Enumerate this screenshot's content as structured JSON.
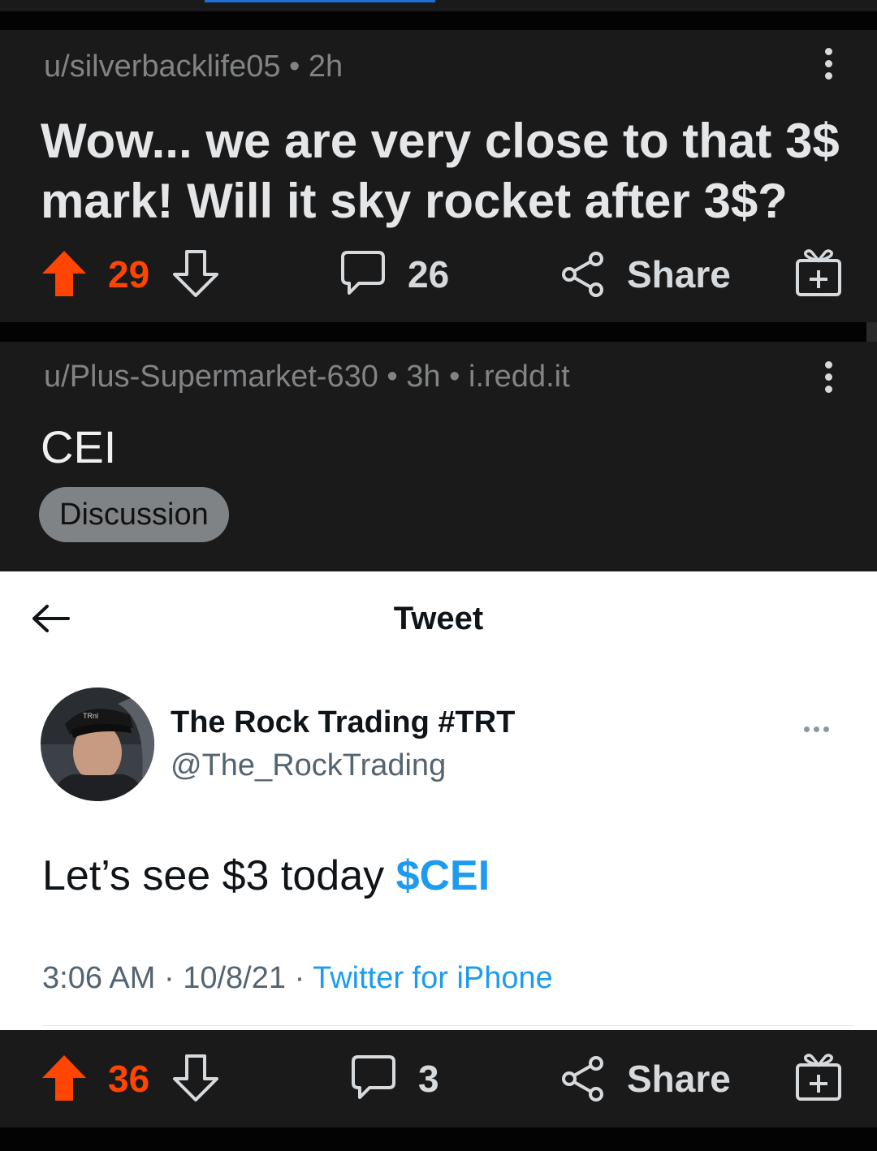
{
  "post1": {
    "author": "u/silverbacklife05",
    "separator": "•",
    "age": "2h",
    "title": "Wow... we are very close to that 3$ mark! Will it sky rocket after 3$?",
    "votes": "29",
    "comments": "26",
    "share_label": "Share"
  },
  "post2": {
    "author": "u/Plus-Supermarket-630",
    "separator": "•",
    "age": "3h",
    "domain": "i.redd.it",
    "title": "CEI",
    "flair": "Discussion",
    "votes": "36",
    "comments": "3",
    "share_label": "Share"
  },
  "tweet": {
    "header_title": "Tweet",
    "display_name": "The Rock Trading #TRT",
    "handle": "@The_RockTrading",
    "text_plain": "Let’s see $3 today ",
    "cashtag": "$CEI",
    "time": "3:06 AM",
    "dot": "·",
    "date": "10/8/21",
    "source": "Twitter for iPhone",
    "cap_text": "TRnl"
  },
  "colors": {
    "upvote": "#ff4500",
    "link": "#1d9bf0",
    "card_bg": "#1a1a1b"
  }
}
